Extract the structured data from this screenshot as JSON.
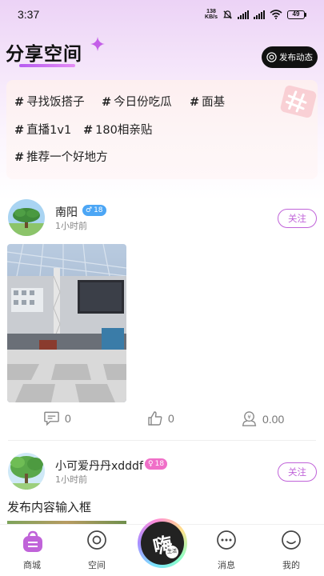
{
  "status_bar": {
    "time": "3:37",
    "net_speed_value": "138",
    "net_speed_unit": "KB/s",
    "battery_level": "49"
  },
  "header": {
    "title": "分享空间",
    "publish_label": "发布动态"
  },
  "topics": [
    {
      "hash": "#",
      "label": "寻找饭搭子"
    },
    {
      "hash": "#",
      "label": "今日份吃瓜"
    },
    {
      "hash": "#",
      "label": "面基"
    },
    {
      "hash": "#",
      "label": "直播1v1"
    },
    {
      "hash": "#",
      "label": "180相亲贴"
    },
    {
      "hash": "#",
      "label": "推荐一个好地方"
    }
  ],
  "posts": [
    {
      "username": "南阳",
      "gender_symbol": "♂",
      "age": "18",
      "time": "1小时前",
      "follow_label": "关注",
      "comments": "0",
      "likes": "0",
      "reward": "0.00"
    },
    {
      "username": "小可爱丹丹xdddf",
      "gender_symbol": "♀",
      "age": "18",
      "time": "1小时前",
      "follow_label": "关注",
      "content": "发布内容输入框"
    }
  ],
  "tab_bar": {
    "items": [
      {
        "label": "商城"
      },
      {
        "label": "空间"
      },
      {
        "label": "消息"
      },
      {
        "label": "我的"
      }
    ],
    "center_char": "嗨",
    "center_sub": "生活"
  },
  "colors": {
    "accent": "#c063d9",
    "male_badge": "#4ca6f5",
    "female_badge": "#f06fc8"
  }
}
